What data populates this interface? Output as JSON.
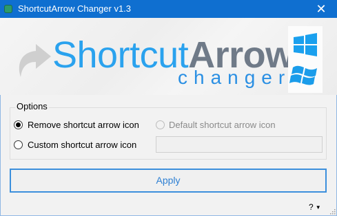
{
  "window": {
    "title": "ShortcutArrow Changer v1.3",
    "close_glyph": "✕"
  },
  "logo": {
    "part1": "Shortcut",
    "part2": "Arrow",
    "subtitle": "changer",
    "colors": {
      "blue": "#1e7fd6",
      "gray": "#6f7a88",
      "light_blue": "#2aa2ee"
    }
  },
  "options": {
    "group_label": "Options",
    "remove_label": "Remove shortcut arrow icon",
    "default_label": "Default shortcut arrow icon",
    "custom_label": "Custom shortcut arrow icon",
    "custom_path_value": "",
    "selected": "remove"
  },
  "apply_label": "Apply",
  "help": {
    "label": "?",
    "caret": "▼"
  },
  "icons": [
    "app-icon",
    "close-icon",
    "shortcut-arrow-icon",
    "windows-10-logo-icon",
    "windows-7-logo-icon",
    "dropdown-caret-icon",
    "size-grip-icon"
  ]
}
